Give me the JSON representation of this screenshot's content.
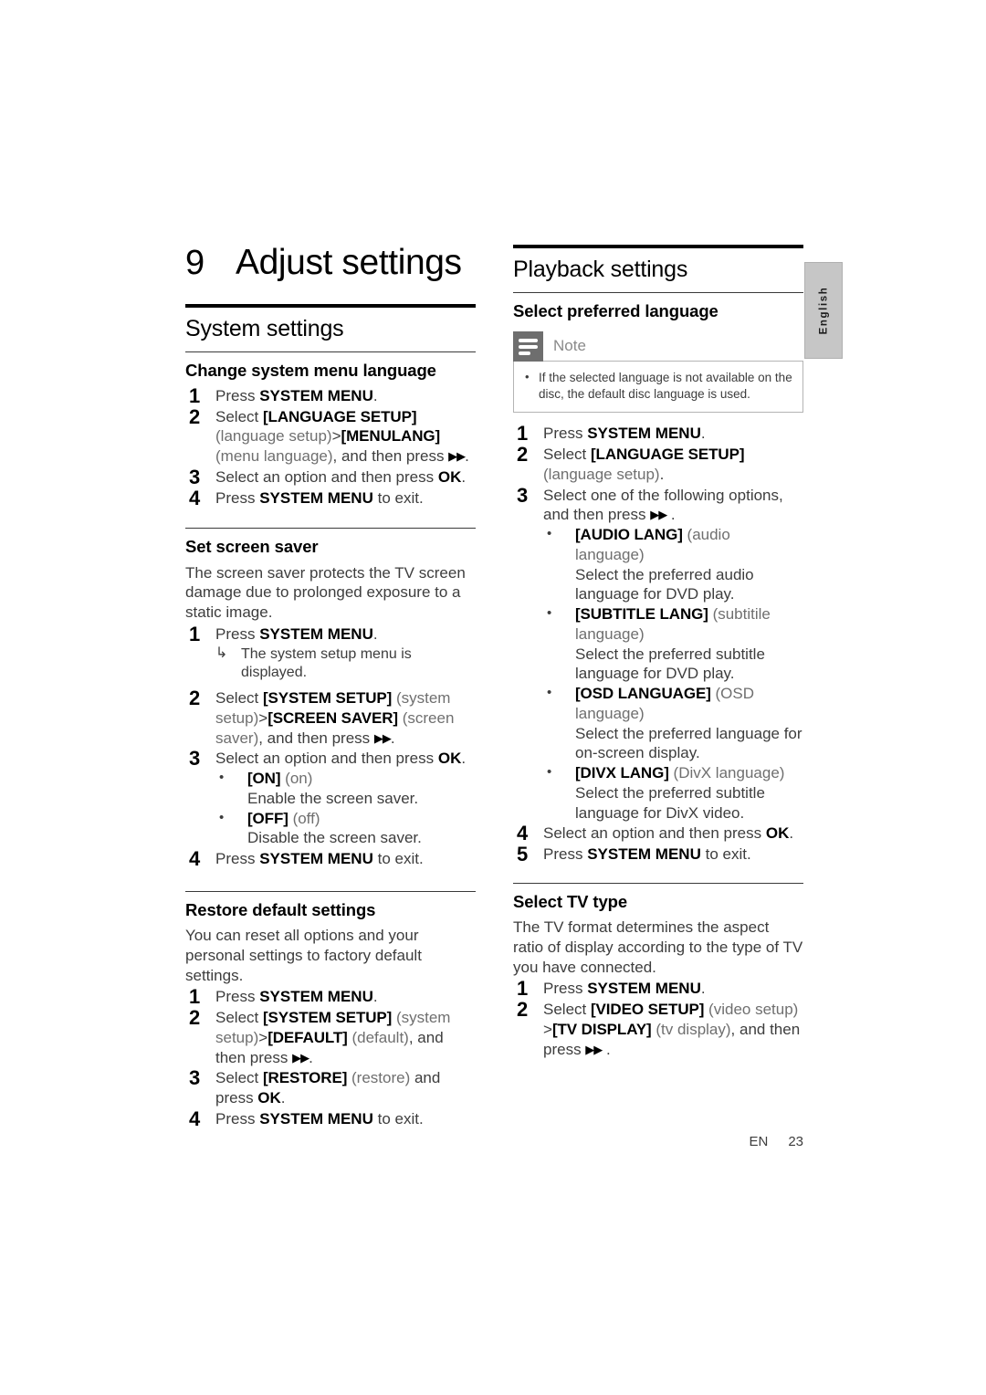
{
  "page": {
    "chapter_number": "9",
    "chapter_title": "Adjust settings",
    "language_tab": "English",
    "footer_lang": "EN",
    "footer_page": "23"
  },
  "left_column": {
    "section_title": "System settings",
    "subsections": [
      {
        "heading": "Change system menu language",
        "steps": [
          "Press SYSTEM MENU.",
          "Select [LANGUAGE SETUP] (language setup)>[MENULANG] (menu language), and then press ▶▶.",
          "Select an option and then press OK.",
          "Press SYSTEM MENU to exit."
        ]
      },
      {
        "heading": "Set screen saver",
        "intro": "The screen saver protects the TV screen damage due to prolonged exposure to a static image.",
        "step1": "Press SYSTEM MENU.",
        "step1_result": "The system setup menu is displayed.",
        "step2": "Select [SYSTEM SETUP] (system setup)>[SCREEN SAVER] (screen saver), and then press ▶▶.",
        "step3": "Select an option and then press OK.",
        "options": [
          {
            "token": "[ON]",
            "gloss": "(on)",
            "desc": "Enable the screen saver."
          },
          {
            "token": "[OFF]",
            "gloss": "(off)",
            "desc": "Disable the screen saver."
          }
        ],
        "step4": "Press SYSTEM MENU to exit."
      },
      {
        "heading": "Restore default settings",
        "intro": "You can reset all options and your personal settings to factory default settings.",
        "steps": [
          "Press SYSTEM MENU.",
          "Select [SYSTEM SETUP] (system setup)>[DEFAULT] (default), and then press ▶▶.",
          "Select [RESTORE] (restore) and press OK.",
          "Press SYSTEM MENU to exit."
        ]
      }
    ]
  },
  "right_column": {
    "section_title": "Playback settings",
    "preferred_language": {
      "heading": "Select preferred language",
      "note": {
        "label": "Note",
        "items": [
          "If the selected language is not available on the disc, the default disc language is used."
        ]
      },
      "step1": "Press SYSTEM MENU.",
      "step2": "Select [LANGUAGE SETUP] (language setup).",
      "step3": "Select one of the following options, and then press ▶▶ .",
      "options": [
        {
          "token": "[AUDIO LANG]",
          "gloss": "(audio language)",
          "desc": "Select the preferred audio language for DVD play."
        },
        {
          "token": "[SUBTITLE LANG]",
          "gloss": "(subtitile language)",
          "desc": "Select the preferred subtitle language for DVD play."
        },
        {
          "token": "[OSD LANGUAGE]",
          "gloss": "(OSD language)",
          "desc": "Select the preferred language for on-screen display."
        },
        {
          "token": "[DIVX LANG]",
          "gloss": "(DivX language)",
          "desc": "Select the preferred subtitle language for DivX video."
        }
      ],
      "step4": "Select an option and then press OK.",
      "step5": "Press SYSTEM MENU to exit."
    },
    "tv_type": {
      "heading": "Select TV type",
      "intro": "The TV format determines the aspect ratio of display according to the type of TV you have connected.",
      "step1": "Press SYSTEM MENU.",
      "step2": "Select [VIDEO SETUP] (video setup) >[TV DISPLAY] (tv display), and then press ▶▶ ."
    }
  }
}
